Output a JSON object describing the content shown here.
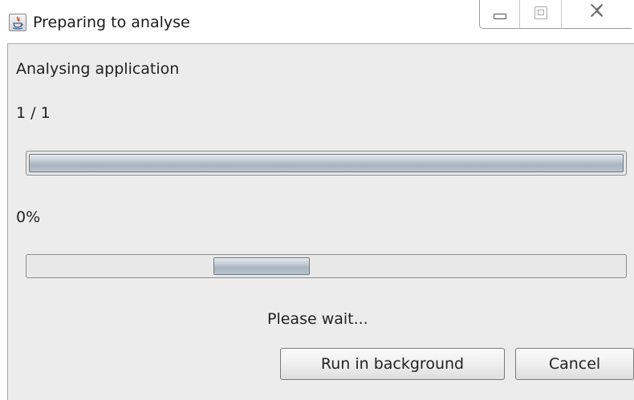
{
  "window": {
    "title": "Preparing to analyse",
    "app_icon": "java-icon",
    "caption_buttons": {
      "minimize_icon": "minimize-icon",
      "maximize_icon": "maximize-icon",
      "close_icon": "close-icon"
    }
  },
  "dialog": {
    "task_label": "Analysing application",
    "step_counter": "1 / 1",
    "overall_progress": {
      "fraction": 1.0
    },
    "percent_label": "0%",
    "detail_progress": {
      "mode": "indeterminate",
      "indicator_position_fraction": 0.37
    },
    "status_text": "Please wait...",
    "buttons": {
      "run_in_background": "Run in background",
      "cancel": "Cancel"
    }
  },
  "colors": {
    "dialog_background": "#ececec",
    "progress_fill": "#b8c2cb"
  }
}
